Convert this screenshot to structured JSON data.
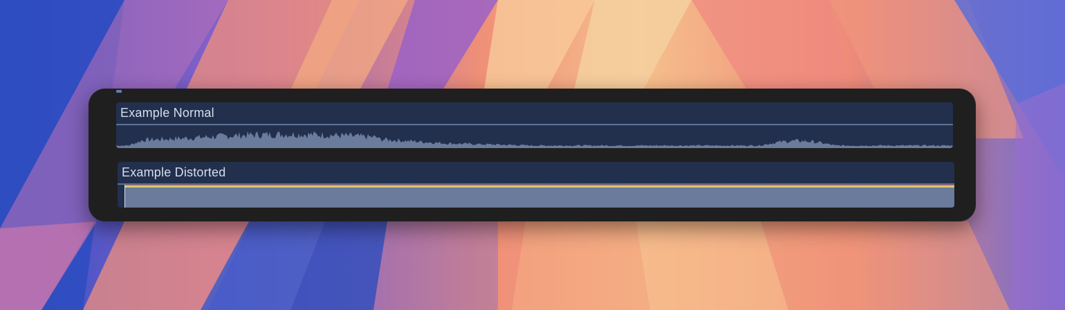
{
  "colors": {
    "window_bg": "#1f1f1f",
    "clip_bg": "#22304d",
    "waveform_fill": "#6a7b9c",
    "clip_line": "#5e7294",
    "peak_yellow": "#e3c66b",
    "peak_red": "#e24a3b"
  },
  "clips": [
    {
      "title": "Example Normal",
      "waveform": "normal"
    },
    {
      "title": "Example Distorted",
      "waveform": "clipped"
    }
  ]
}
